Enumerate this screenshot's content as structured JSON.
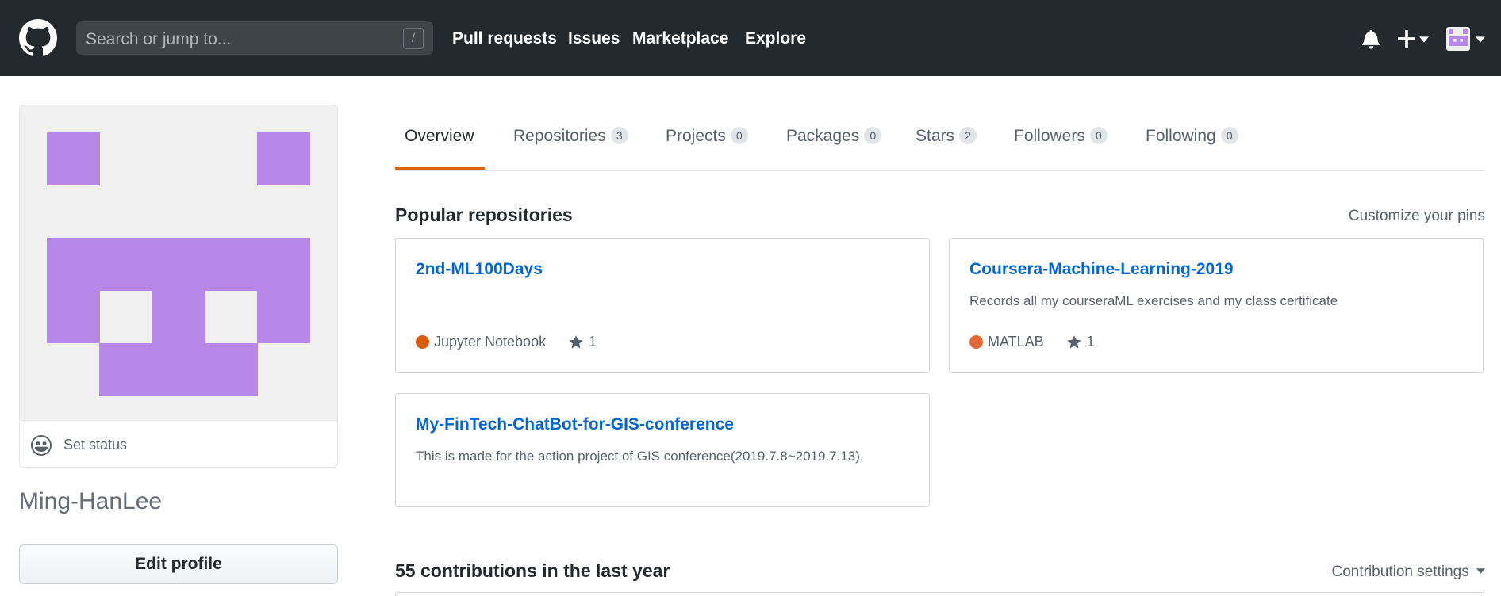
{
  "header": {
    "search_placeholder": "Search or jump to...",
    "search_shortcut": "/",
    "nav": [
      {
        "label": "Pull requests"
      },
      {
        "label": "Issues"
      },
      {
        "label": "Marketplace"
      },
      {
        "label": "Explore"
      }
    ],
    "icons": [
      "github-logo-icon",
      "bell-icon",
      "plus-icon",
      "avatar"
    ]
  },
  "profile": {
    "set_status_label": "Set status",
    "username": "Ming-HanLee",
    "edit_profile_label": "Edit profile",
    "avatar_color": "#b888e8"
  },
  "tabs": [
    {
      "label": "Overview",
      "count": null,
      "active": true
    },
    {
      "label": "Repositories",
      "count": "3"
    },
    {
      "label": "Projects",
      "count": "0"
    },
    {
      "label": "Packages",
      "count": "0"
    },
    {
      "label": "Stars",
      "count": "2"
    },
    {
      "label": "Followers",
      "count": "0"
    },
    {
      "label": "Following",
      "count": "0"
    }
  ],
  "popular": {
    "title": "Popular repositories",
    "customize_label": "Customize your pins",
    "repos": [
      {
        "name": "2nd-ML100Days",
        "description": "",
        "language": "Jupyter Notebook",
        "language_color": "#da5b0b",
        "stars": "1"
      },
      {
        "name": "Coursera-Machine-Learning-2019",
        "description": "Records all my courseraML exercises and my class certificate",
        "language": "MATLAB",
        "language_color": "#e16737",
        "stars": "1"
      },
      {
        "name": "My-FinTech-ChatBot-for-GIS-conference",
        "description": "This is made for the action project of GIS conference(2019.7.8~2019.7.13).",
        "language": "",
        "stars": ""
      }
    ]
  },
  "contributions": {
    "title": "55 contributions in the last year",
    "settings_label": "Contribution settings"
  },
  "colors": {
    "header_bg": "#24292e",
    "link": "#0366d6",
    "tab_accent": "#e36209"
  }
}
